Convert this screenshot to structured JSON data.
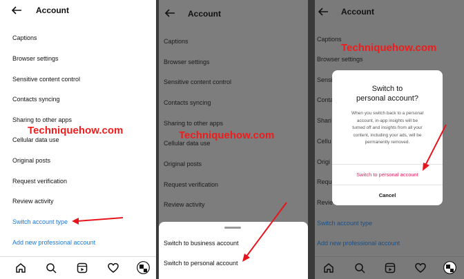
{
  "header": {
    "title": "Account"
  },
  "menu": {
    "items": [
      "Captions",
      "Browser settings",
      "Sensitive content control",
      "Contacts syncing",
      "Sharing to other apps",
      "Cellular data use",
      "Original posts",
      "Request verification",
      "Review activity"
    ],
    "switch_label": "Switch account type",
    "add_label": "Add new professional account"
  },
  "panel3_items": [
    "Captions",
    "Browser settings",
    "Sensi",
    "Conta",
    "Shari",
    "Cellu",
    "Origi",
    "Requ",
    "Revie"
  ],
  "sheet": {
    "business": "Switch to business account",
    "personal": "Switch to personal account"
  },
  "dialog": {
    "title_line1": "Switch to",
    "title_line2": "personal account?",
    "body": "When you switch back to a personal account, in-app insights will be turned off and insights from all your content, including your ads, will be permanently removed.",
    "confirm": "Switch to personal account",
    "cancel": "Cancel"
  },
  "watermark": "Techniquehow.com",
  "nav_icons": [
    "home-icon",
    "search-icon",
    "reels-icon",
    "heart-icon",
    "profile-avatar"
  ],
  "colors": {
    "accent_blue": "#1877d6",
    "destructive": "#e0245e",
    "annotation_red": "#e8141c"
  }
}
